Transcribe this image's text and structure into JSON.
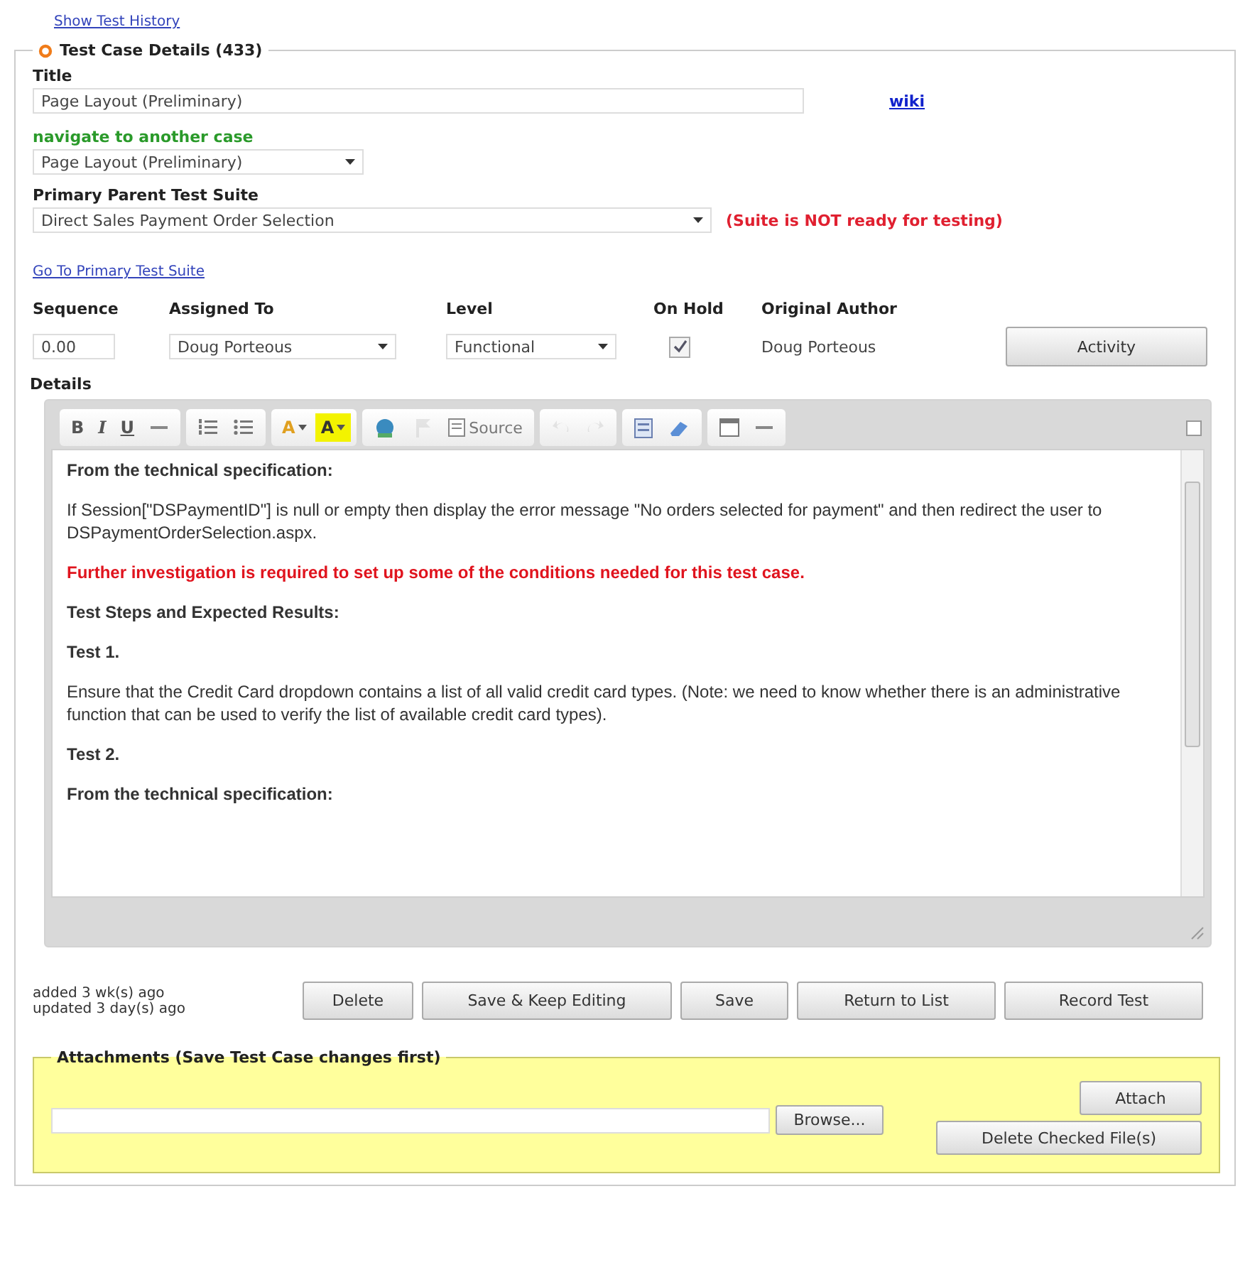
{
  "history_link": "Show Test History",
  "details": {
    "legend": "Test Case Details (433)",
    "title_label": "Title",
    "title_value": "Page Layout (Preliminary)",
    "wiki_link": "wiki",
    "navigate_label": "navigate to another case",
    "navigate_value": "Page Layout (Preliminary)",
    "suite_label": "Primary Parent Test Suite",
    "suite_value": "Direct Sales Payment Order Selection",
    "suite_status": "(Suite is NOT ready for testing)",
    "suite_link": "Go To Primary Test Suite",
    "fields": [
      {
        "kind": "input",
        "label": "Sequence",
        "value": "0.00"
      },
      {
        "kind": "select",
        "label": "Assigned To",
        "value": "Doug Porteous"
      },
      {
        "kind": "select",
        "label": "Level",
        "value": "Functional"
      },
      {
        "kind": "checkbox",
        "label": "On Hold",
        "checked": true
      },
      {
        "kind": "text",
        "label": "Original Author",
        "value": "Doug Porteous"
      }
    ],
    "activity_button": "Activity",
    "details_label": "Details",
    "toolbar": [
      [
        {
          "kind": "bold",
          "label": "B"
        },
        {
          "kind": "italic",
          "label": "I"
        },
        {
          "kind": "underline",
          "label": "U"
        },
        {
          "kind": "strike"
        }
      ],
      [
        {
          "kind": "numbered-list"
        },
        {
          "kind": "bullet-list"
        }
      ],
      [
        {
          "kind": "text-color",
          "label": "A"
        },
        {
          "kind": "bg-color",
          "label": "A"
        }
      ],
      [
        {
          "kind": "link"
        },
        {
          "kind": "anchor",
          "disabled": true
        },
        {
          "kind": "source",
          "label": "Source"
        }
      ],
      [
        {
          "kind": "undo",
          "disabled": true
        },
        {
          "kind": "redo",
          "disabled": true
        }
      ],
      [
        {
          "kind": "page"
        },
        {
          "kind": "eraser"
        }
      ],
      [
        {
          "kind": "table"
        },
        {
          "kind": "rule"
        }
      ]
    ],
    "content": [
      {
        "kind": "heading",
        "text": "From the technical specification:"
      },
      {
        "kind": "text",
        "text": "If Session[\"DSPaymentID\"] is null or empty then display the error message \"No orders selected for payment\" and then redirect the user to DSPaymentOrderSelection.aspx."
      },
      {
        "kind": "alert",
        "text": "Further investigation is required to set up some of the conditions needed for this test case."
      },
      {
        "kind": "heading",
        "text": "Test Steps and Expected Results:"
      },
      {
        "kind": "heading",
        "text": "Test 1."
      },
      {
        "kind": "text",
        "text": "Ensure that the Credit Card dropdown contains a list of all valid credit card types. (Note: we need to know whether there is an administrative function that can be used to verify the list of available credit card types)."
      },
      {
        "kind": "heading",
        "text": "Test 2."
      },
      {
        "kind": "heading",
        "text": "From the technical specification:"
      }
    ],
    "added": "added 3 wk(s) ago",
    "updated": "updated 3 day(s) ago",
    "buttons": [
      "Delete",
      "Save & Keep Editing",
      "Save",
      "Return to List",
      "Record Test"
    ],
    "attachments": {
      "legend": "Attachments (Save Test Case changes first)",
      "browse_button": "Browse...",
      "attach_button": "Attach",
      "delete_button": "Delete Checked File(s)"
    }
  }
}
